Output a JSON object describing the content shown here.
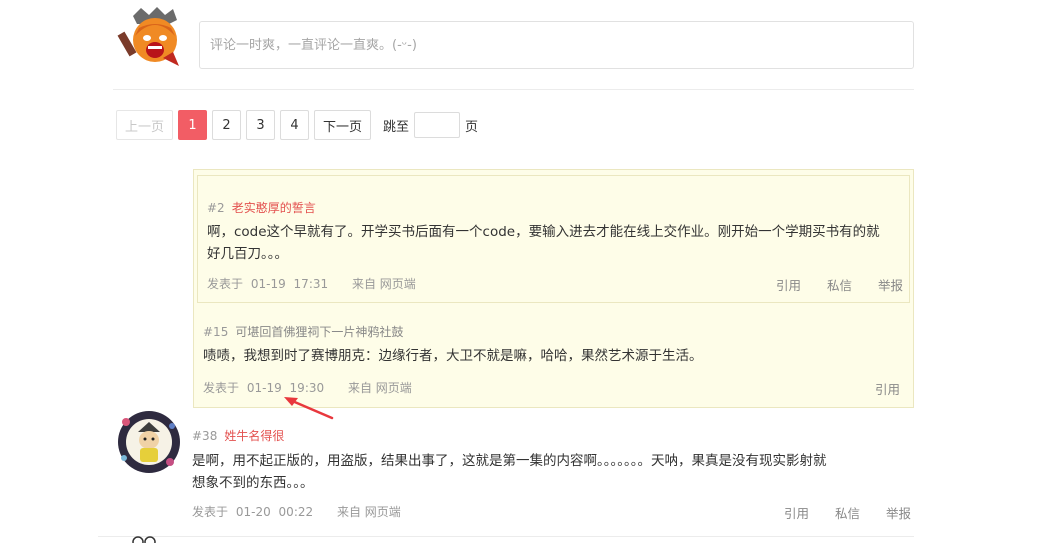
{
  "composer": {
    "placeholder": "评论一时爽，一直评论一直爽。(-ᵕ-)"
  },
  "pagination": {
    "prev_label": "上一页",
    "pages": [
      "1",
      "2",
      "3",
      "4"
    ],
    "active_page": "1",
    "next_label": "下一页",
    "jump_label": "跳至",
    "page_suffix": "页"
  },
  "quoted_reply": {
    "floor": "#2",
    "user": "老实憨厚的誓言",
    "text_line1": "啊，code这个早就有了。开学买书后面有一个code，要输入进去才能在线上交作业。刚开始一个学期买书有的就",
    "text_line2": "好几百刀。。。",
    "posted_label": "发表于",
    "date": "01-19",
    "time": "17:31",
    "source": "来自 网页端",
    "actions": [
      "引用",
      "私信",
      "举报"
    ]
  },
  "nested_reply": {
    "floor": "#15",
    "user": "可堪回首佛狸祠下一片神鸦社鼓",
    "text": "啧啧，我想到时了赛博朋克：边缘行者，大卫不就是嘛，哈哈，果然艺术源于生活。",
    "posted_label": "发表于",
    "date": "01-19",
    "time": "19:30",
    "source": "来自 网页端",
    "actions": [
      "引用"
    ]
  },
  "comment_38": {
    "floor": "#38",
    "user": "姓牛名得很",
    "text_line1": "是啊，用不起正版的，用盗版，结果出事了，这就是第一集的内容啊。。。。。。。天呐，果真是没有现实影射就",
    "text_line2": "想象不到的东西。。。",
    "posted_label": "发表于",
    "date": "01-20",
    "time": "00:22",
    "source": "来自 网页端",
    "actions": [
      "引用",
      "私信",
      "举报"
    ]
  },
  "colors": {
    "accent": "#f25d65",
    "username": "#e3514f",
    "quote_bg": "#fefde8",
    "annotation_arrow": "#e8383d"
  }
}
